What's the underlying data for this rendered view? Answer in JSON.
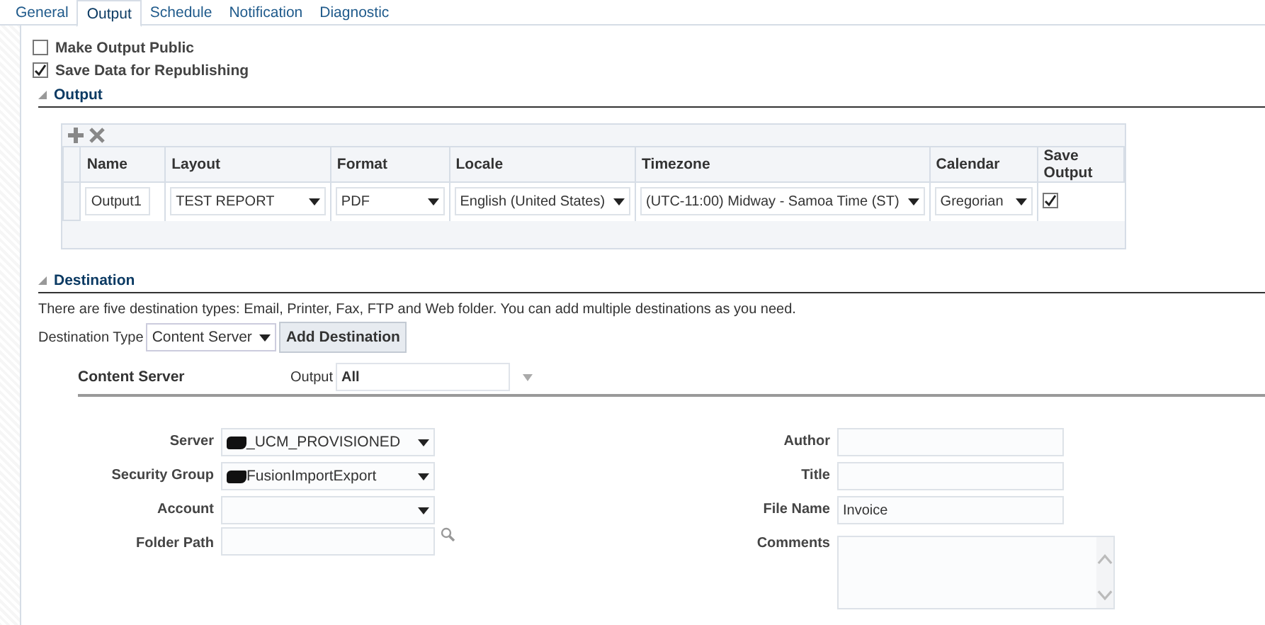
{
  "tabs": [
    {
      "label": "General",
      "selected": false
    },
    {
      "label": "Output",
      "selected": true
    },
    {
      "label": "Schedule",
      "selected": false
    },
    {
      "label": "Notification",
      "selected": false
    },
    {
      "label": "Diagnostic",
      "selected": false
    }
  ],
  "options": [
    {
      "label": "Make Output Public",
      "checked": false
    },
    {
      "label": "Save Data for Republishing",
      "checked": true
    }
  ],
  "output_section": {
    "title": "Output",
    "table": {
      "columns": [
        "Name",
        "Layout",
        "Format",
        "Locale",
        "Timezone",
        "Calendar",
        "Save Output"
      ],
      "rows": [
        {
          "name": "Output1",
          "layout": "TEST REPORT",
          "format": "PDF",
          "locale": "English (United States)",
          "timezone": "(UTC-11:00) Midway - Samoa Time (ST)",
          "calendar": "Gregorian",
          "save_output": true
        }
      ]
    }
  },
  "destination": {
    "title": "Destination",
    "description": "There are five destination types: Email, Printer, Fax, FTP and Web folder. You can add multiple destinations as you need.",
    "type_label": "Destination Type",
    "type_value": "Content Server",
    "add_button": "Add Destination",
    "content_server": {
      "title": "Content Server",
      "output_label": "Output",
      "output_value": "All"
    },
    "left_fields": [
      {
        "label": "Server",
        "value": "_UCM_PROVISIONED",
        "kind": "select",
        "redacted": true
      },
      {
        "label": "Security Group",
        "value": "FusionImportExport",
        "kind": "select",
        "redacted": true
      },
      {
        "label": "Account",
        "kind": "select",
        "redacted": false
      },
      {
        "label": "Folder Path",
        "kind": "lookup",
        "redacted": false
      }
    ],
    "right_fields": [
      {
        "label": "Author",
        "kind": "text"
      },
      {
        "label": "Title",
        "kind": "text"
      },
      {
        "label": "File Name",
        "value": "Invoice",
        "kind": "text"
      },
      {
        "label": "Comments",
        "kind": "textarea"
      }
    ]
  }
}
